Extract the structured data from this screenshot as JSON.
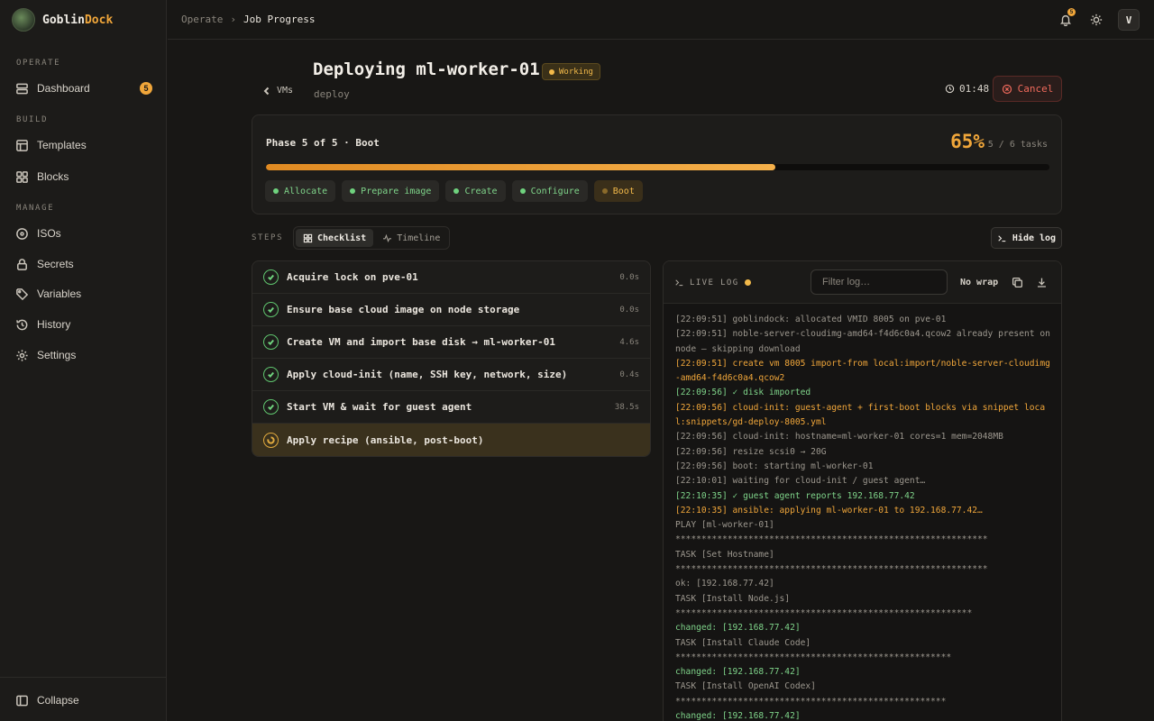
{
  "brand": {
    "name_a": "Goblin",
    "name_b": "Dock",
    "logo_text": "GoblinDock"
  },
  "sidebar": {
    "sections": [
      "OPERATE",
      "BUILD",
      "MANAGE"
    ],
    "items": [
      {
        "label": "Dashboard",
        "icon": "server-icon",
        "badge": "5"
      },
      {
        "label": "Templates",
        "icon": "layout-icon"
      },
      {
        "label": "Blocks",
        "icon": "grid-icon"
      },
      {
        "label": "ISOs",
        "icon": "disc-icon"
      },
      {
        "label": "Secrets",
        "icon": "lock-icon"
      },
      {
        "label": "Variables",
        "icon": "tag-icon"
      },
      {
        "label": "History",
        "icon": "history-icon"
      },
      {
        "label": "Settings",
        "icon": "gear-icon"
      }
    ],
    "collapse_label": "Collapse"
  },
  "topbar": {
    "breadcrumb_parent": "Operate",
    "breadcrumb_current": "Job Progress",
    "notification_count": "5",
    "avatar_initial": "V"
  },
  "header": {
    "back_label": "VMs",
    "title": "Deploying ml-worker-01",
    "status": "Working",
    "subtitle": "deploy",
    "elapsed": "01:48",
    "cancel_label": "Cancel"
  },
  "phase": {
    "label": "Phase 5 of 5 · Boot",
    "percent_text": "65%",
    "progress": 0.65,
    "tasks_text": "5 / 6 tasks",
    "phases": [
      {
        "label": "Allocate",
        "state": "done"
      },
      {
        "label": "Prepare image",
        "state": "done"
      },
      {
        "label": "Create",
        "state": "done"
      },
      {
        "label": "Configure",
        "state": "done"
      },
      {
        "label": "Boot",
        "state": "active"
      }
    ]
  },
  "steps": {
    "section_label": "STEPS",
    "view_checklist": "Checklist",
    "view_timeline": "Timeline",
    "hide_log_label": "Hide log",
    "items": [
      {
        "label": "Acquire lock on pve-01",
        "duration": "0.0s",
        "state": "done"
      },
      {
        "label": "Ensure base cloud image on node storage",
        "duration": "0.0s",
        "state": "done"
      },
      {
        "label": "Create VM and import base disk → ml-worker-01",
        "duration": "4.6s",
        "state": "done"
      },
      {
        "label": "Apply cloud-init (name, SSH key, network, size)",
        "duration": "0.4s",
        "state": "done"
      },
      {
        "label": "Start VM & wait for guest agent",
        "duration": "38.5s",
        "state": "done"
      },
      {
        "label": "Apply recipe (ansible, post-boot)",
        "duration": "",
        "state": "running"
      }
    ]
  },
  "log": {
    "title": "LIVE LOG",
    "filter_placeholder": "Filter log…",
    "wrap_label": "No wrap",
    "lines": [
      {
        "text": "[22:09:51] goblindock: allocated VMID 8005 on pve-01",
        "kind": "info"
      },
      {
        "text": "[22:09:51] noble-server-cloudimg-amd64-f4d6c0a4.qcow2 already present on node — skipping download",
        "kind": "info"
      },
      {
        "text": "[22:09:51] create vm 8005 import-from local:import/noble-server-cloudimg-amd64-f4d6c0a4.qcow2",
        "kind": "warn"
      },
      {
        "text": "[22:09:56] ✓ disk imported",
        "kind": "ok"
      },
      {
        "text": "[22:09:56] cloud-init: guest-agent + first-boot blocks via snippet local:snippets/gd-deploy-8005.yml",
        "kind": "warn"
      },
      {
        "text": "[22:09:56] cloud-init: hostname=ml-worker-01 cores=1 mem=2048MB",
        "kind": "info"
      },
      {
        "text": "[22:09:56] resize scsi0 → 20G",
        "kind": "info"
      },
      {
        "text": "[22:09:56] boot: starting ml-worker-01",
        "kind": "info"
      },
      {
        "text": "[22:10:01] waiting for cloud-init / guest agent…",
        "kind": "info"
      },
      {
        "text": "[22:10:35] ✓ guest agent reports 192.168.77.42",
        "kind": "ok"
      },
      {
        "text": "[22:10:35] ansible: applying ml-worker-01 to 192.168.77.42…",
        "kind": "warn"
      },
      {
        "text": "PLAY [ml-worker-01]",
        "kind": "info"
      },
      {
        "text": "************************************************************",
        "kind": "info"
      },
      {
        "text": "TASK [Set Hostname]",
        "kind": "info"
      },
      {
        "text": "************************************************************",
        "kind": "info"
      },
      {
        "text": "ok: [192.168.77.42]",
        "kind": "info"
      },
      {
        "text": "TASK [Install Node.js]",
        "kind": "info"
      },
      {
        "text": "*********************************************************",
        "kind": "info"
      },
      {
        "text": "changed: [192.168.77.42]",
        "kind": "ok"
      },
      {
        "text": "TASK [Install Claude Code]",
        "kind": "info"
      },
      {
        "text": "*****************************************************",
        "kind": "info"
      },
      {
        "text": "changed: [192.168.77.42]",
        "kind": "ok"
      },
      {
        "text": "TASK [Install OpenAI Codex]",
        "kind": "info"
      },
      {
        "text": "****************************************************",
        "kind": "info"
      },
      {
        "text": "changed: [192.168.77.42]",
        "kind": "ok"
      }
    ]
  }
}
